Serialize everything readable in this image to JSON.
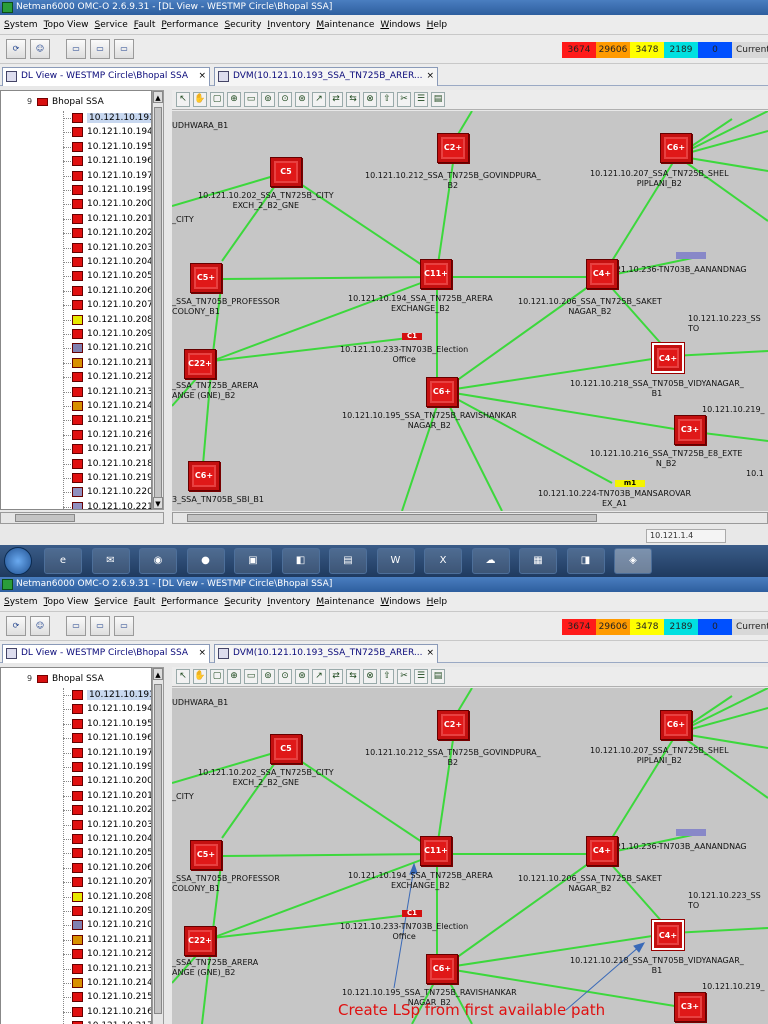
{
  "window": {
    "title": "Netman6000 OMC-O 2.6.9.31 - [DL View - WESTMP Circle\\Bhopal SSA]"
  },
  "menu": [
    "System",
    "Topo View",
    "Service",
    "Fault",
    "Performance",
    "Security",
    "Inventory",
    "Maintenance",
    "Windows",
    "Help"
  ],
  "alarm_counts": {
    "critical": "3674",
    "major": "29606",
    "minor": "3478",
    "warning": "2189",
    "indeterminate": "0",
    "current_label": "Current",
    "colors": {
      "critical": "#ff1a1a",
      "major": "#ff9a00",
      "minor": "#ffff00",
      "warning": "#00e0e0",
      "indeterminate": "#0050ff"
    }
  },
  "tabs": [
    {
      "label": "DL View - WESTMP Circle\\Bhopal SSA",
      "close": "×"
    },
    {
      "label": "DVM(10.121.10.193_SSA_TN725B_ARER...",
      "close": "×"
    }
  ],
  "tree": {
    "root": "Bhopal SSA",
    "root_expander": "9",
    "items": [
      {
        "label": "10.121.10.193",
        "color": "#e01010",
        "selected": true
      },
      {
        "label": "10.121.10.194",
        "color": "#e01010"
      },
      {
        "label": "10.121.10.195",
        "color": "#e01010"
      },
      {
        "label": "10.121.10.196",
        "color": "#e01010"
      },
      {
        "label": "10.121.10.197",
        "color": "#e01010"
      },
      {
        "label": "10.121.10.199",
        "color": "#e01010"
      },
      {
        "label": "10.121.10.200",
        "color": "#e01010"
      },
      {
        "label": "10.121.10.201",
        "color": "#e01010"
      },
      {
        "label": "10.121.10.202",
        "color": "#e01010"
      },
      {
        "label": "10.121.10.203",
        "color": "#e01010"
      },
      {
        "label": "10.121.10.204",
        "color": "#e01010"
      },
      {
        "label": "10.121.10.205",
        "color": "#e01010"
      },
      {
        "label": "10.121.10.206",
        "color": "#e01010"
      },
      {
        "label": "10.121.10.207",
        "color": "#e01010"
      },
      {
        "label": "10.121.10.208",
        "color": "#e8e800"
      },
      {
        "label": "10.121.10.209",
        "color": "#e01010"
      },
      {
        "label": "10.121.10.210",
        "color": "#8080b0"
      },
      {
        "label": "10.121.10.211",
        "color": "#d89000"
      },
      {
        "label": "10.121.10.212",
        "color": "#e01010"
      },
      {
        "label": "10.121.10.213",
        "color": "#e01010"
      },
      {
        "label": "10.121.10.214",
        "color": "#d89000"
      },
      {
        "label": "10.121.10.215",
        "color": "#e01010"
      },
      {
        "label": "10.121.10.216",
        "color": "#e01010"
      },
      {
        "label": "10.121.10.217",
        "color": "#e01010"
      },
      {
        "label": "10.121.10.218",
        "color": "#e01010"
      },
      {
        "label": "10.121.10.219",
        "color": "#e01010"
      },
      {
        "label": "10.121.10.220",
        "color": "#9090c0"
      },
      {
        "label": "10.121.10.221",
        "color": "#9090c0"
      }
    ]
  },
  "status": {
    "ip": "10.121.1.4"
  },
  "map": {
    "labels": {
      "udhwara": "UDHWARA_B1",
      "city_excl": "10.121.10.202_SSA_TN725B_CITY\nEXCH_2_B2_GNE",
      "govindpura": "10.121.10.212_SSA_TN725B_GOVINDPURA_\nB2",
      "shelpipl": "10.121.10.207_SSA_TN725B_SHEL\nPIPLANI_B2",
      "city": "_CITY",
      "aanand": "10.121.10.236-TN703B_AANANDNAG",
      "professor": "_SSA_TN705B_PROFESSOR\nCOLONY_B1",
      "arera_ex": "10.121.10.194_SSA_TN725B_ARERA\nEXCHANGE_B2",
      "saket": "10.121.10.206_SSA_TN725B_SAKET\nNAGAR_B2",
      "ip223": "10.121.10.223_SS\nTO",
      "election": "10.121.10.233-TN703B_Election\nOffice",
      "arera_gne": "_SSA_TN725B_ARERA\nANGE (GNE)_B2",
      "ravishankar": "10.121.10.195_SSA_TN725B_RAVISHANKAR\nNAGAR_B2",
      "vidyanagar": "10.121.10.218_SSA_TN705B_VIDYANAGAR_\nB1",
      "ip219": "10.121.10.219_",
      "e8": "10.121.10.216_SSA_TN725B_E8_EXTE\nN_B2",
      "ip10": "10.1",
      "sbi": "3_SSA_TN705B_SBI_B1",
      "mansarovar": "10.121.10.224-TN703B_MANSAROVAR\nEX_A1"
    },
    "nodes": {
      "c5": "C5",
      "c2": "C2+",
      "c6": "C6+",
      "c5b": "C5+",
      "c11": "C11+",
      "c4a": "C4+",
      "c4b": "C4+",
      "c22": "C22+",
      "c6b": "C6+",
      "c3": "C3+",
      "c6c": "C6+",
      "c1": "C1",
      "m1": "m1"
    }
  },
  "annotation": "Create LSp from first available path",
  "taskbar": [
    "e",
    "✉",
    "◉",
    "●",
    "▣",
    "◧",
    "▤",
    "W",
    "X",
    "☁",
    "▦",
    "◨",
    "◈"
  ]
}
